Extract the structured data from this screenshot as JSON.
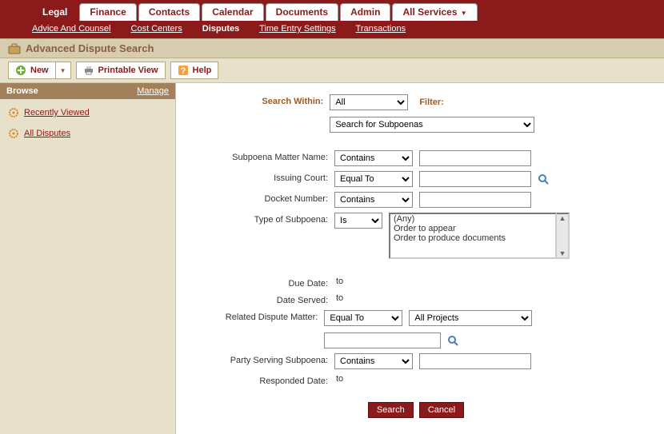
{
  "tabs": [
    "Legal",
    "Finance",
    "Contacts",
    "Calendar",
    "Documents",
    "Admin",
    "All Services"
  ],
  "subnav": [
    "Advice And Counsel",
    "Cost Centers",
    "Disputes",
    "Time Entry Settings",
    "Transactions"
  ],
  "subnav_active": "Disputes",
  "title": "Advanced Dispute Search",
  "toolbar": {
    "new": "New",
    "print": "Printable View",
    "help": "Help"
  },
  "sidebar": {
    "head": "Browse",
    "manage": "Manage",
    "items": [
      "Recently Viewed",
      "All Disputes"
    ]
  },
  "labels": {
    "search_within": "Search Within:",
    "filter": "Filter:",
    "subpoena_name": "Subpoena Matter Name:",
    "issuing_court": "Issuing Court:",
    "docket_number": "Docket Number:",
    "type_subpoena": "Type of Subpoena:",
    "due_date": "Due Date:",
    "date_served": "Date Served:",
    "related_dispute": "Related Dispute Matter:",
    "party_serving": "Party Serving Subpoena:",
    "responded_date": "Responded Date:",
    "to": "to"
  },
  "values": {
    "search_within": "All",
    "filter": "Search for Subpoenas",
    "op_contains": "Contains",
    "op_equal": "Equal To",
    "op_is": "Is",
    "all_projects": "All Projects",
    "type_options": [
      "(Any)",
      "Order to appear",
      "Order to produce documents"
    ]
  },
  "buttons": {
    "search": "Search",
    "cancel": "Cancel"
  }
}
